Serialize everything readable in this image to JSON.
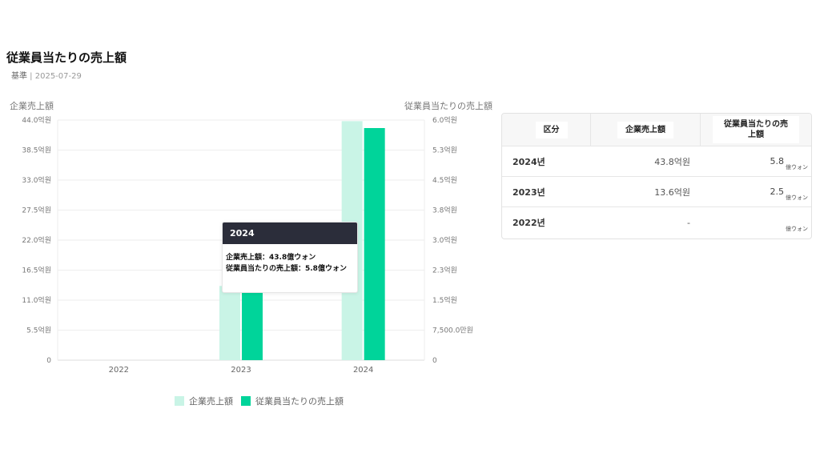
{
  "header": {
    "title": "従業員当たりの売上額",
    "basis_label": "基準",
    "basis_date": "2025-07-29"
  },
  "colors": {
    "revenue": "#c9f4e6",
    "per_employee": "#00d49a",
    "grid": "#eeeeee",
    "tooltip_header": "#2b2d3a"
  },
  "chart_data": {
    "type": "bar",
    "categories": [
      "2022",
      "2023",
      "2024"
    ],
    "series": [
      {
        "name": "企業売上額",
        "values": [
          0,
          13.6,
          43.8
        ],
        "axis": "left"
      },
      {
        "name": "従業員当たりの売上額",
        "values": [
          0,
          2.5,
          5.8
        ],
        "axis": "right"
      }
    ],
    "y_left": {
      "title": "企業売上額",
      "range": [
        0,
        44
      ],
      "ticks": [
        0,
        5.5,
        11,
        16.5,
        22,
        27.5,
        33,
        38.5,
        44
      ],
      "tick_labels": [
        "0",
        "5.5억원",
        "11.0억원",
        "16.5억원",
        "22.0억원",
        "27.5억원",
        "33.0억원",
        "38.5억원",
        "44.0억원"
      ]
    },
    "y_right": {
      "title": "従業員当たりの売上額",
      "range": [
        0,
        6
      ],
      "ticks": [
        0,
        0.75,
        1.5,
        2.25,
        3,
        3.75,
        4.5,
        5.25,
        6
      ],
      "tick_labels": [
        "0",
        "7,500.0만원",
        "1.5억원",
        "2.3억원",
        "3.0억원",
        "3.8억원",
        "4.5억원",
        "5.3억원",
        "6.0억원"
      ]
    },
    "grid": true,
    "legend_position": "bottom"
  },
  "tooltip": {
    "title": "2024",
    "line1": "企業売上額：43.8億ウォン",
    "line2": "従業員当たりの売上額：5.8億ウォン"
  },
  "table": {
    "headers": [
      "区分",
      "企業売上額",
      "従業員当たりの売上額"
    ],
    "rows": [
      {
        "year": "2024년",
        "revenue": "43.8억원",
        "per_employee": "5.8",
        "unit": "億ウォン"
      },
      {
        "year": "2023년",
        "revenue": "13.6억원",
        "per_employee": "2.5",
        "unit": "億ウォン"
      },
      {
        "year": "2022년",
        "revenue": "-",
        "per_employee": "",
        "unit": "億ウォン"
      }
    ]
  }
}
